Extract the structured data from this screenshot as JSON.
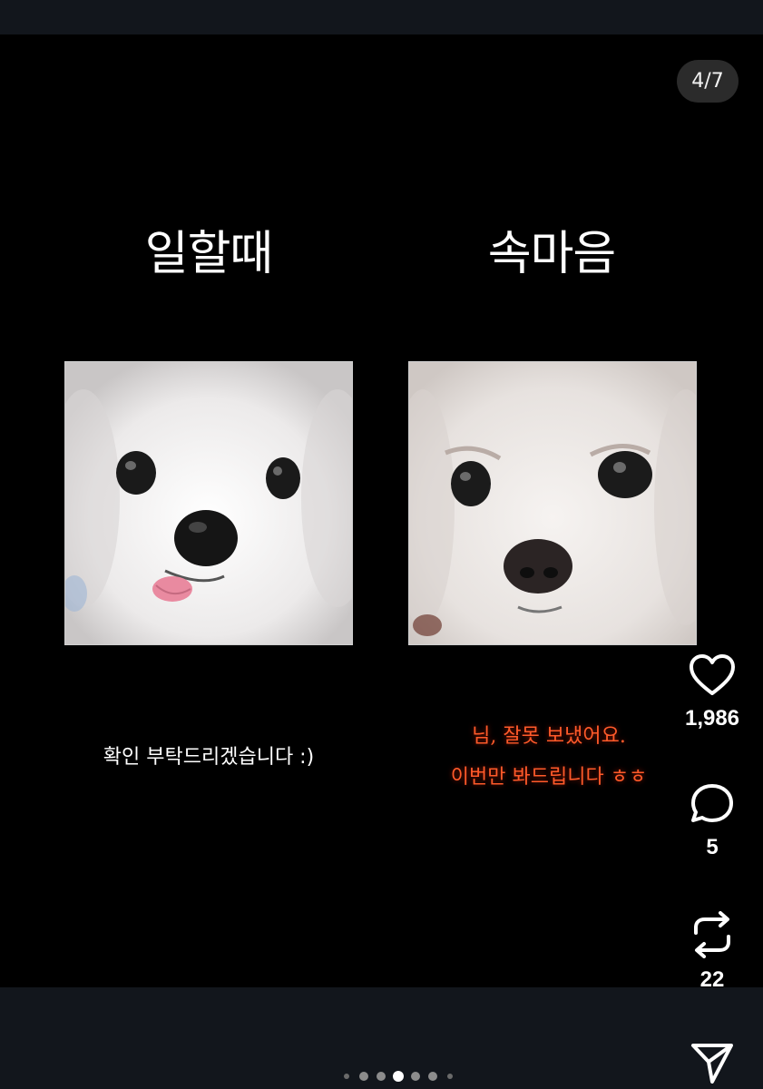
{
  "slide_counter": "4/7",
  "panels": {
    "left": {
      "heading": "일할때",
      "caption": "확인 부탁드리겠습니다 :)"
    },
    "right": {
      "heading": "속마음",
      "caption_line1": "님, 잘못 보냈어요.",
      "caption_line2": "이번만 봐드립니다 ㅎㅎ"
    }
  },
  "actions": {
    "like": {
      "icon": "heart-icon",
      "count": "1,986"
    },
    "reply": {
      "icon": "comment-bubble-icon",
      "count": "5"
    },
    "repost": {
      "icon": "repost-arrows-icon",
      "count": "22"
    },
    "share": {
      "icon": "send-icon"
    }
  },
  "carousel": {
    "total": 7,
    "active_index": 4
  },
  "colors": {
    "background": "#000000",
    "bar": "#12161c",
    "caption_accent": "#ff5a2a"
  }
}
